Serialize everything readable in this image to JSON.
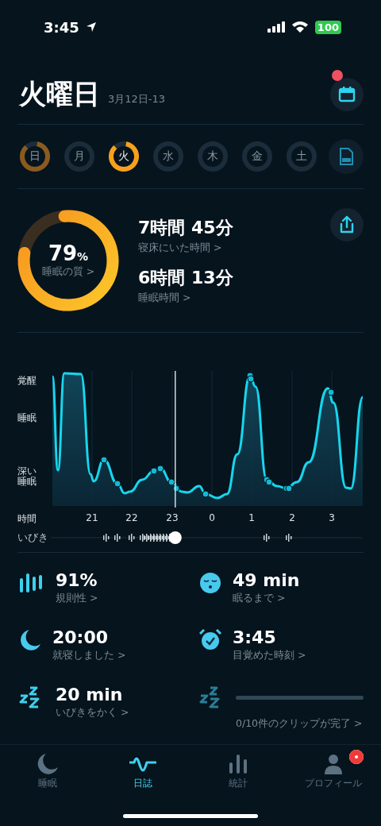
{
  "status_bar": {
    "time": "3:45",
    "battery": "100"
  },
  "header": {
    "title": "火曜日",
    "date": "3月12日-13",
    "calendar_badge": true
  },
  "days": [
    {
      "label": "日",
      "recorded": true,
      "selected": false
    },
    {
      "label": "月",
      "recorded": false,
      "selected": false
    },
    {
      "label": "火",
      "recorded": true,
      "selected": true
    },
    {
      "label": "水",
      "recorded": false,
      "selected": false
    },
    {
      "label": "木",
      "recorded": false,
      "selected": false
    },
    {
      "label": "金",
      "recorded": false,
      "selected": false
    },
    {
      "label": "土",
      "recorded": false,
      "selected": false
    }
  ],
  "summary": {
    "quality": {
      "value": "79",
      "unit": "%",
      "label": "睡眠の質 >"
    },
    "metrics": [
      {
        "value": "7時間 45分",
        "label": "寝床にいた時間 >"
      },
      {
        "value": "6時間 13分",
        "label": "睡眠時間 >"
      }
    ]
  },
  "hypnogram": {
    "y_labels": [
      "覚醒",
      "睡眠",
      "深い睡眠"
    ],
    "x_title": "時間",
    "x_ticks": [
      "21",
      "22",
      "23",
      "0",
      "1",
      "2",
      "3"
    ],
    "snore_label": "いびき",
    "playhead": {
      "level": 0.4
    }
  },
  "stats": [
    {
      "kind": "metric",
      "value": "91%",
      "label": "規則性 >"
    },
    {
      "kind": "metric",
      "value": "49 min",
      "label": "眠るまで >"
    },
    {
      "kind": "metric",
      "value": "20:00",
      "label": "就寝しました >"
    },
    {
      "kind": "metric",
      "value": "3:45",
      "label": "目覚めた時刻 >"
    },
    {
      "kind": "metric",
      "value": "20 min",
      "label": "いびきをかく >"
    },
    {
      "kind": "progress",
      "label": "0/10件のクリップが完了 >"
    }
  ],
  "tabs": [
    {
      "label": "睡眠",
      "selected": false,
      "badge": false
    },
    {
      "label": "日誌",
      "selected": true,
      "badge": false
    },
    {
      "label": "統計",
      "selected": false,
      "badge": false
    },
    {
      "label": "プロフィール",
      "selected": false,
      "badge": true
    }
  ]
}
